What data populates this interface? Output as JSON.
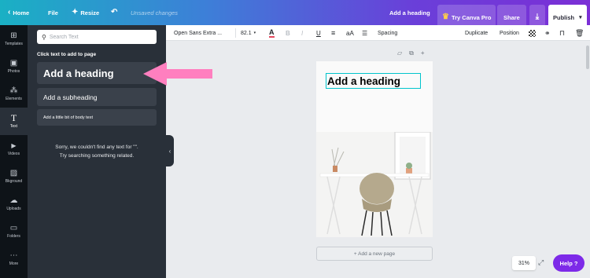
{
  "topbar": {
    "home": "Home",
    "file": "File",
    "resize": "Resize",
    "unsaved": "Unsaved changes",
    "doc_title": "Add a heading",
    "try_pro": "Try Canva Pro",
    "share": "Share",
    "publish": "Publish"
  },
  "rail": [
    {
      "label": "Templates",
      "icon": "⊞"
    },
    {
      "label": "Photos",
      "icon": "▣"
    },
    {
      "label": "Elements",
      "icon": "⁂"
    },
    {
      "label": "Text",
      "icon": "T"
    },
    {
      "label": "Videos",
      "icon": "▶"
    },
    {
      "label": "Bkground",
      "icon": "▨"
    },
    {
      "label": "Uploads",
      "icon": "☁"
    },
    {
      "label": "Folders",
      "icon": "▭"
    },
    {
      "label": "More",
      "icon": "⋯"
    }
  ],
  "panel": {
    "search_placeholder": "Search Text",
    "click_label": "Click text to add to page",
    "heading": "Add a heading",
    "subheading": "Add a subheading",
    "body": "Add a little bit of body text",
    "no_results_1": "Sorry, we couldn't find any text for \"\".",
    "no_results_2": "Try searching something related."
  },
  "toolbar": {
    "font": "Open Sans Extra ...",
    "size": "82.1",
    "case": "aA",
    "spacing": "Spacing",
    "duplicate": "Duplicate",
    "position": "Position"
  },
  "canvas": {
    "heading": "Add a heading",
    "add_page": "+ Add a new page"
  },
  "footer": {
    "zoom": "31%",
    "help": "Help ?"
  },
  "colors": {
    "accent": "#7d2ae8",
    "arrow": "#ff7fbf",
    "selection": "#00c4cc"
  }
}
